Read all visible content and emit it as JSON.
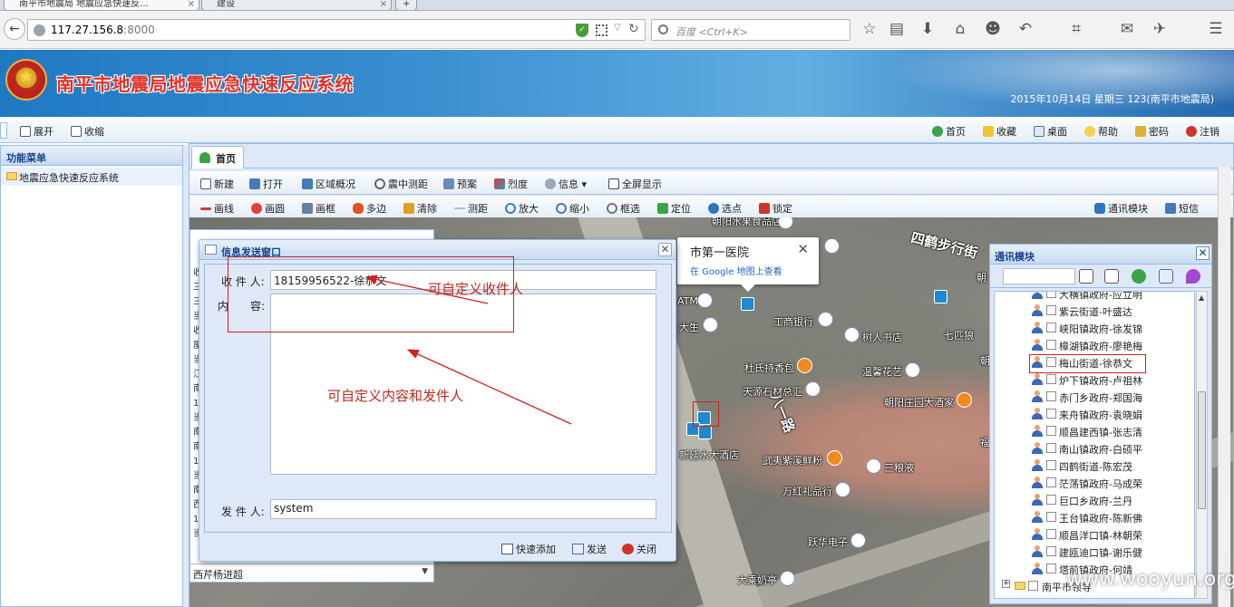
{
  "browser": {
    "tabs": [
      {
        "label": "南平市地震局 地震应急快速反..."
      },
      {
        "label": "建设"
      },
      {
        "label": "+"
      }
    ],
    "url_host": "117.27.156.8",
    "url_port": ":8000",
    "search_placeholder": "百度 <Ctrl+K>"
  },
  "app": {
    "title": "南平市地震局地震应急快速反应系统",
    "date_user": "2015年10月14日 星期三  123(南平市地震局)",
    "toolbar_left": [
      {
        "label": "展开"
      },
      {
        "label": "收缩"
      }
    ],
    "toolbar_right": [
      {
        "label": "首页"
      },
      {
        "label": "收藏"
      },
      {
        "label": "桌面"
      },
      {
        "label": "帮助"
      },
      {
        "label": "密码"
      },
      {
        "label": "注销"
      }
    ],
    "brand_color": "#e0322a"
  },
  "left_panel": {
    "header": "功能菜单",
    "items": [
      {
        "label": "地震应急快速反应系统"
      }
    ]
  },
  "main": {
    "tab": "首页",
    "toolbar1": [
      {
        "label": "新建",
        "icon": "new-file-icon"
      },
      {
        "label": "打开",
        "icon": "open-icon"
      },
      {
        "label": "区域概况",
        "icon": "region-icon"
      },
      {
        "label": "震中测距",
        "icon": "radio-icon"
      },
      {
        "label": "预案",
        "icon": "plan-icon"
      },
      {
        "label": "烈度",
        "icon": "intensity-icon"
      },
      {
        "label": "信息",
        "icon": "info-icon"
      },
      {
        "label": "全屏显示",
        "icon": "fullscreen-icon"
      }
    ],
    "toolbar2": [
      {
        "label": "画线"
      },
      {
        "label": "画圆"
      },
      {
        "label": "画框"
      },
      {
        "label": "多边"
      },
      {
        "label": "清除"
      },
      {
        "label": "测距"
      },
      {
        "label": "放大"
      },
      {
        "label": "缩小"
      },
      {
        "label": "框选"
      },
      {
        "label": "定位"
      },
      {
        "label": "选点"
      },
      {
        "label": "锁定"
      }
    ],
    "toolbar2_right": [
      {
        "label": "通讯模块"
      },
      {
        "label": "短信"
      }
    ]
  },
  "map": {
    "road_label_1": "四鹤步行街",
    "road_label_2": "八一路",
    "pois": [
      "朝阳水果食品店",
      "工商银行",
      "树人书店",
      "七匹狼",
      "杜氏持香包",
      "温馨花艺",
      "天源石材总汇",
      "朝阳庄园大酒家",
      "新延水大酒店",
      "武夷紫溪鲜粉",
      "三粮液",
      "万红礼品行",
      "跃华电子",
      "大乘奶亭",
      "大生",
      "ATM",
      "朝",
      "福"
    ],
    "popup": {
      "title": "市第一医院",
      "link": "在 Google 地图上查看"
    }
  },
  "under_panel": {
    "combo_value": "西芹杨进超",
    "strip_chars": [
      "收",
      "三",
      "三",
      "当",
      "收",
      "屋",
      "当",
      "江",
      "南",
      "1(",
      "当",
      "南",
      "南",
      "1(",
      "当",
      "南",
      "西",
      "1",
      "当"
    ]
  },
  "dialog": {
    "title": "信息发送窗口",
    "recipient_label": "收 件 人:",
    "recipient_value": "18159956522-徐恭文",
    "content_label": "内　　容:",
    "content_value": "",
    "sender_label": "发 件 人:",
    "sender_value": "system",
    "buttons": [
      {
        "label": "快速添加"
      },
      {
        "label": "发送"
      },
      {
        "label": "关闭"
      }
    ]
  },
  "annotations": {
    "recipient_note": "可自定义收件人",
    "content_note": "可自定义内容和发件人"
  },
  "comm_panel": {
    "title": "通讯模块",
    "contacts": [
      "大横镇政府-应立明",
      "紫云街道-叶盛达",
      "峡阳镇政府-徐发锦",
      "樟湖镇政府-廖艳梅",
      "梅山街道-徐恭文",
      "炉下镇政府-卢祖林",
      "赤门乡政府-郑国海",
      "来舟镇政府-袁晓娟",
      "顺昌建西镇-张志清",
      "南山镇政府-白硕平",
      "四鹤街道-陈宏茂",
      "茫荡镇政府-马成荣",
      "巨口乡政府-兰丹",
      "王台镇政府-陈新佛",
      "顺昌洋口镇-林朝荣",
      "建瓯迪口镇-谢乐健",
      "塔前镇政府-何靖"
    ],
    "group": "南平市领导",
    "highlight": "梅山街道-徐恭文"
  },
  "watermark": "www.wooyun.org"
}
